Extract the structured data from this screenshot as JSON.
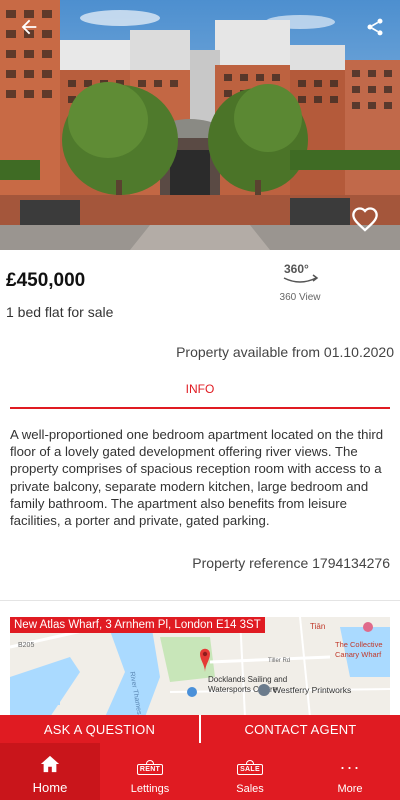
{
  "listing": {
    "price": "£450,000",
    "subtitle": "1 bed flat for sale",
    "view360_label": "360 View",
    "view360_glyph": "360°",
    "availability": "Property available from 01.10.2020",
    "reference": "Property reference 1794134276"
  },
  "tabs": {
    "info_label": "INFO"
  },
  "description": "A well-proportioned one bedroom apartment located on the third floor of a lovely gated development offering river views. The property comprises of spacious reception room with access to a private balcony, separate modern kitchen, large bedroom and family bathroom. The apartment also benefits from leisure facilities, a porter and private, gated parking.",
  "map": {
    "address": "New Atlas Wharf, 3 Arnhem Pl, London E14 3ST",
    "labels": {
      "sailing_1": "Docklands Sailing and",
      "sailing_2": "Watersports Centre",
      "printworks": "Westferry Printworks",
      "collective_1": "The Collective",
      "collective_2": "Canary Wharf",
      "river_1": "River Thames",
      "tian": "Tiān",
      "tiller": "Tiller Rd",
      "b205": "B205"
    }
  },
  "actions": {
    "ask_question": "ASK A QUESTION",
    "contact_agent": "CONTACT AGENT"
  },
  "nav": {
    "home": "Home",
    "lettings": "Lettings",
    "lettings_sign": "RENT",
    "sales": "Sales",
    "sales_sign": "SALE",
    "more": "More",
    "more_glyph": "···"
  },
  "colors": {
    "brand_red": "#e01b22",
    "nav_active": "#c9151b"
  },
  "icons": [
    "back-arrow-icon",
    "share-icon",
    "heart-icon",
    "360-view-icon",
    "map-pin-icon",
    "home-icon",
    "rent-sign-icon",
    "sale-sign-icon",
    "more-dots-icon"
  ]
}
